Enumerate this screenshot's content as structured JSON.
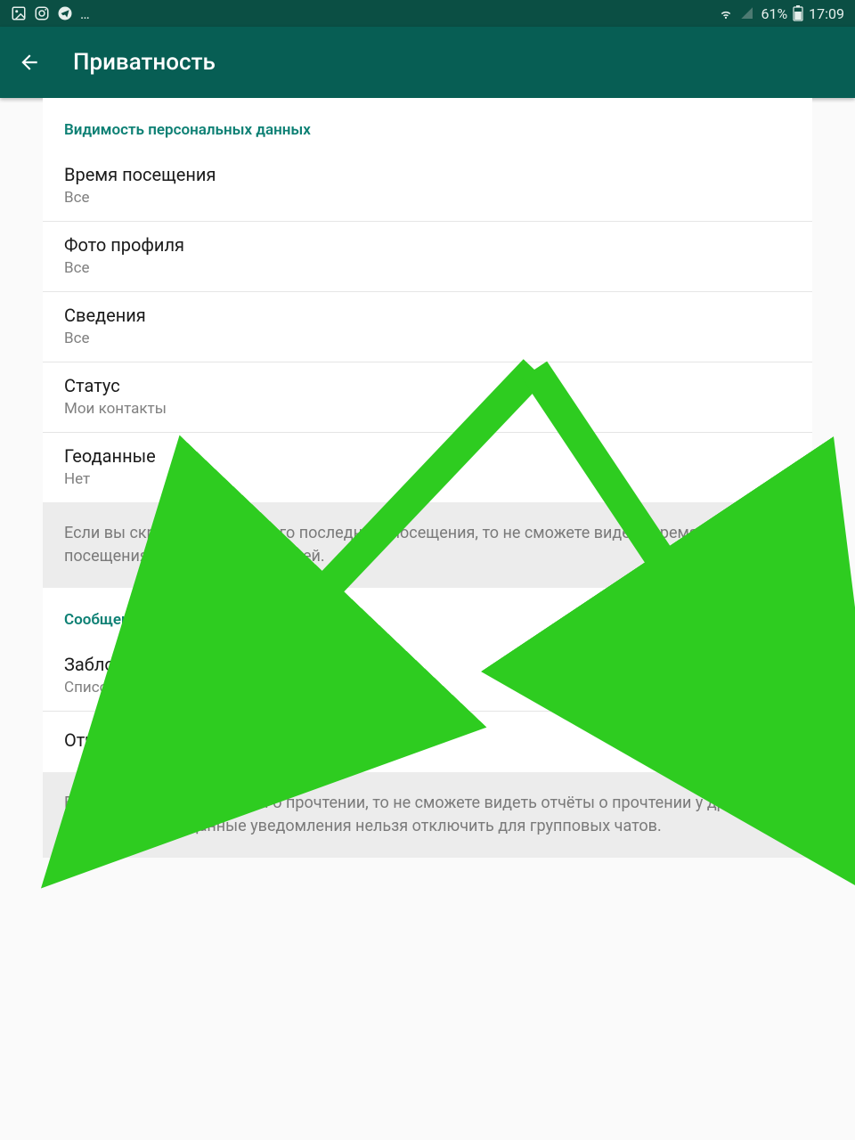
{
  "status": {
    "battery": "61%",
    "time": "17:09"
  },
  "appbar": {
    "title": "Приватность"
  },
  "section1": {
    "header": "Видимость персональных данных",
    "lastSeen": {
      "title": "Время посещения",
      "value": "Все"
    },
    "photo": {
      "title": "Фото профиля",
      "value": "Все"
    },
    "about": {
      "title": "Сведения",
      "value": "Все"
    },
    "status": {
      "title": "Статус",
      "value": "Мои контакты"
    },
    "location": {
      "title": "Геоданные",
      "value": "Нет"
    },
    "info": "Если вы скроете время своего последнего посещения, то не сможете видеть время последнего посещения других пользователей."
  },
  "section2": {
    "header": "Сообщения",
    "blocked": {
      "title": "Заблокированные",
      "value": "Список заблокированных контактов."
    },
    "read": {
      "title": "Отчёты о прочтении"
    },
    "info": "Если вы отключите отчёты о прочтении, то не сможете видеть отчёты о прочтении у других пользователей. Данные уведомления нельзя отключить для групповых чатов."
  }
}
